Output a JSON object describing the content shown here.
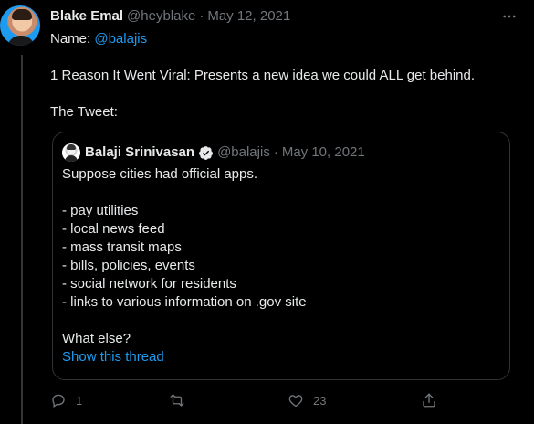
{
  "author": {
    "name": "Blake Emal",
    "handle": "@heyblake",
    "separator": "·",
    "date": "May 12, 2021"
  },
  "tweet": {
    "name_prefix": "Name: ",
    "name_link": "@balajis",
    "line_reason": "1 Reason It Went Viral: Presents a new idea we could ALL get behind.",
    "line_tweet": "The Tweet:"
  },
  "quote": {
    "name": "Balaji Srinivasan",
    "handle": "@balajis",
    "separator": "·",
    "date": "May 10, 2021",
    "line1": "Suppose cities had official apps.",
    "items": [
      "- pay utilities",
      "- local news feed",
      "- mass transit maps",
      "- bills, policies, events",
      "- social network for residents",
      "- links to various information on .gov site"
    ],
    "closing": "What else?",
    "show_thread": "Show this thread"
  },
  "actions": {
    "reply_count": "1",
    "retweet_count": "",
    "like_count": "23"
  },
  "colors": {
    "background": "#000000",
    "text": "#e7e9ea",
    "muted": "#71767b",
    "accent": "#1d9bf0",
    "border": "#2f3336"
  },
  "icons": [
    "more-icon",
    "verified-icon",
    "reply-icon",
    "retweet-icon",
    "like-icon",
    "share-icon"
  ]
}
